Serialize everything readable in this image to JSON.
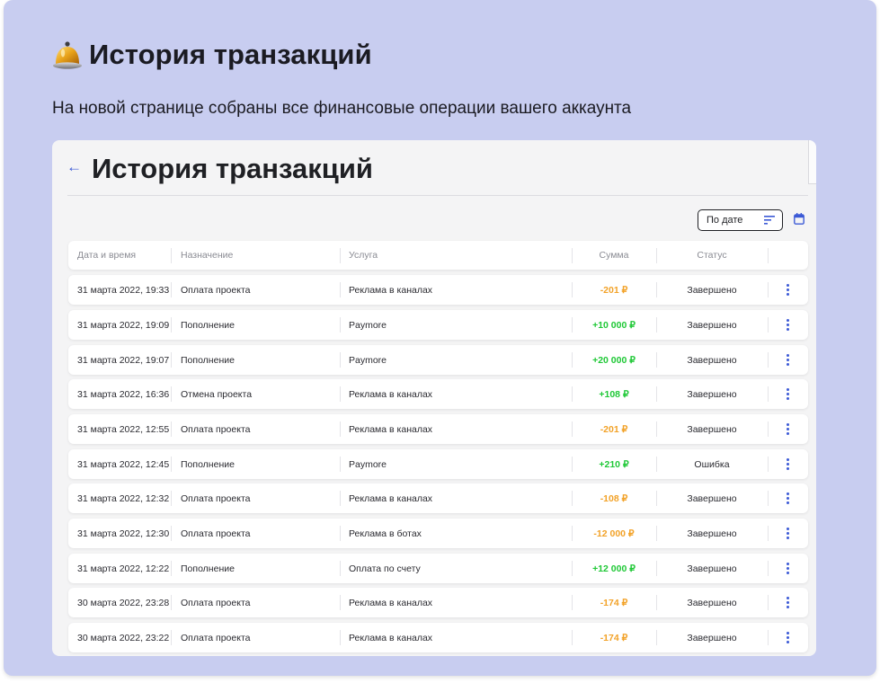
{
  "header": {
    "title": "История транзакций",
    "subtitle": "На новой странице собраны все финансовые операции вашего аккаунта"
  },
  "page": {
    "title": "История транзакций"
  },
  "sort": {
    "label": "По дате"
  },
  "table": {
    "columns": [
      "Дата и время",
      "Назначение",
      "Услуга",
      "Сумма",
      "Статус"
    ],
    "rows": [
      {
        "date": "31 марта 2022, 19:33",
        "purpose": "Оплата проекта",
        "service": "Реклама в каналах",
        "amount": "-201 ₽",
        "status": "Завершено"
      },
      {
        "date": "31 марта 2022, 19:09",
        "purpose": "Пополнение",
        "service": "Paymore",
        "amount": "+10 000 ₽",
        "status": "Завершено"
      },
      {
        "date": "31 марта 2022, 19:07",
        "purpose": "Пополнение",
        "service": "Paymore",
        "amount": "+20 000 ₽",
        "status": "Завершено"
      },
      {
        "date": "31 марта 2022, 16:36",
        "purpose": "Отмена проекта",
        "service": "Реклама в каналах",
        "amount": "+108 ₽",
        "status": "Завершено"
      },
      {
        "date": "31 марта 2022, 12:55",
        "purpose": "Оплата проекта",
        "service": "Реклама в каналах",
        "amount": "-201 ₽",
        "status": "Завершено"
      },
      {
        "date": "31 марта 2022, 12:45",
        "purpose": "Пополнение",
        "service": "Paymore",
        "amount": "+210 ₽",
        "status": "Ошибка"
      },
      {
        "date": "31 марта 2022, 12:32",
        "purpose": "Оплата проекта",
        "service": "Реклама в каналах",
        "amount": "-108 ₽",
        "status": "Завершено"
      },
      {
        "date": "31 марта 2022, 12:30",
        "purpose": "Оплата проекта",
        "service": "Реклама в ботах",
        "amount": "-12 000 ₽",
        "status": "Завершено"
      },
      {
        "date": "31 марта 2022, 12:22",
        "purpose": "Пополнение",
        "service": "Оплата по счету",
        "amount": "+12 000 ₽",
        "status": "Завершено"
      },
      {
        "date": "30 марта 2022, 23:28",
        "purpose": "Оплата проекта",
        "service": "Реклама в каналах",
        "amount": "-174 ₽",
        "status": "Завершено"
      },
      {
        "date": "30 марта 2022, 23:22",
        "purpose": "Оплата проекта",
        "service": "Реклама в каналах",
        "amount": "-174 ₽",
        "status": "Завершено"
      }
    ]
  },
  "colors": {
    "accent": "#3c5ad6",
    "positive": "#1fc836",
    "negative": "#f2a228",
    "background": "#c8cdf0"
  },
  "icons": {
    "header": "bell-icon",
    "back": "back-arrow-icon",
    "sort": "sort-icon",
    "calendar": "calendar-icon",
    "row_menu": "more-vertical-icon"
  }
}
